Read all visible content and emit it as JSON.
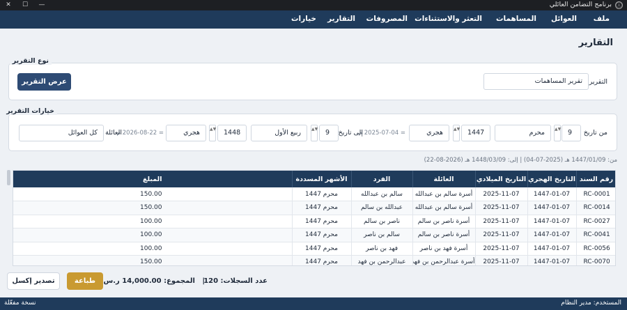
{
  "window": {
    "title": "برنامج التضامن العائلي",
    "app_icon": "ⓘ",
    "close": "✕",
    "maximize": "☐",
    "minimize": "—"
  },
  "menu": {
    "file": "ملف",
    "families": "العوائل",
    "contributions": "المساهمات",
    "defaults": "التعثر والاستثناءات",
    "expenses": "المصروفات",
    "reports": "التقارير",
    "options": "خيارات"
  },
  "page_title": "التقارير",
  "report_type": {
    "legend": "نوع التقرير",
    "label": "التقرير",
    "value": "تقرير المساهمات",
    "show_button": "عرض التقرير"
  },
  "options": {
    "legend": "خيارات التقرير",
    "from_label": "من تاريخ",
    "from_day": "9",
    "from_month": "محرم",
    "from_year": "1447",
    "from_calendar": "هجري",
    "from_gregorian": "= 2025-07-04 م",
    "to_label": "إلى تاريخ",
    "to_day": "9",
    "to_month": "ربيع الأول",
    "to_year": "1448",
    "to_calendar": "هجري",
    "to_gregorian": "= 2026-08-22 م",
    "family_label": "العائلة",
    "family_value": "كل العوائل",
    "spin_arrows": "▲▼"
  },
  "range_text": "من: 1447/01/09 هـ (2025-07-04)   |   إلى: 1448/03/09 هـ (2026-08-22)",
  "table": {
    "headers": {
      "amount": "المبلغ",
      "months": "الأشهر المسددة",
      "member": "الفرد",
      "family": "العائلة",
      "greg_date": "التاريخ الميلادي",
      "hijri_date": "التاريخ الهجري",
      "receipt": "رقم السند"
    },
    "rows": [
      {
        "amount": "150.00",
        "months": "محرم 1447",
        "member": "سالم بن عبدالله",
        "family": "أسرة سالم بن عبدالله",
        "greg": "2025-11-07",
        "hijri": "1447-01-07",
        "receipt": "RC-0001"
      },
      {
        "amount": "150.00",
        "months": "محرم 1447",
        "member": "عبدالله بن سالم",
        "family": "أسرة سالم بن عبدالله",
        "greg": "2025-11-07",
        "hijri": "1447-01-07",
        "receipt": "RC-0014"
      },
      {
        "amount": "100.00",
        "months": "محرم 1447",
        "member": "ناصر بن سالم",
        "family": "أسرة ناصر بن سالم",
        "greg": "2025-11-07",
        "hijri": "1447-01-07",
        "receipt": "RC-0027"
      },
      {
        "amount": "100.00",
        "months": "محرم 1447",
        "member": "سالم بن ناصر",
        "family": "أسرة ناصر بن سالم",
        "greg": "2025-11-07",
        "hijri": "1447-01-07",
        "receipt": "RC-0041"
      },
      {
        "amount": "100.00",
        "months": "محرم 1447",
        "member": "فهد بن ناصر",
        "family": "أسرة فهد بن ناصر",
        "greg": "2025-11-07",
        "hijri": "1447-01-07",
        "receipt": "RC-0056"
      },
      {
        "amount": "150.00",
        "months": "محرم 1447",
        "member": "عبدالرحمن بن فهد",
        "family": "أسرة عبدالرحمن بن فهد",
        "greg": "2025-11-07",
        "hijri": "1447-01-07",
        "receipt": "RC-0070"
      }
    ]
  },
  "footer": {
    "record_count": "عدد السجلات: 120",
    "separator": "|",
    "total": "المجموع: 14,000.00 ر.س",
    "print_button": "طباعة",
    "export_button": "تصدير إكسل"
  },
  "status": {
    "user": "المستخدم: مدير النظام",
    "edition": "نسخة مفعّلة"
  }
}
